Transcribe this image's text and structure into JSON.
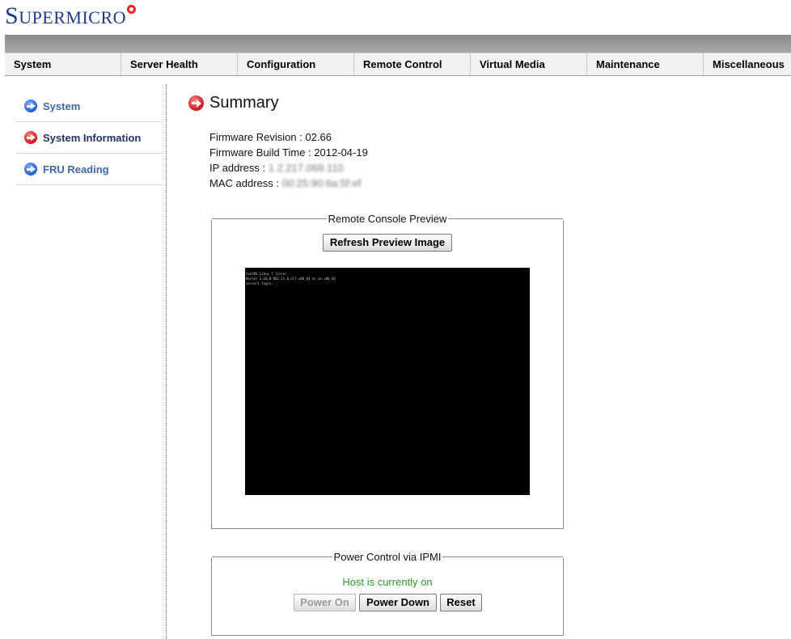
{
  "brand": {
    "logo_text_big": "S",
    "logo_text_rest": "UPERMICRO"
  },
  "nav": {
    "items": [
      "System",
      "Server Health",
      "Configuration",
      "Remote Control",
      "Virtual Media",
      "Maintenance",
      "Miscellaneous"
    ]
  },
  "sidebar": {
    "items": [
      {
        "label": "System",
        "icon": "arrow-right-blue-icon"
      },
      {
        "label": "System Information",
        "icon": "arrow-right-red-icon",
        "active": true
      },
      {
        "label": "FRU Reading",
        "icon": "arrow-right-blue-icon"
      }
    ]
  },
  "summary": {
    "title": "Summary",
    "firmware_revision_label": "Firmware Revision :",
    "firmware_revision": "02.66",
    "firmware_build_label": "Firmware Build Time :",
    "firmware_build": "2012-04-19",
    "ip_label": "IP address :",
    "ip_value": "1.2.217.069.110",
    "mac_label": "MAC address :",
    "mac_value": "00:25:90:6a:5f:ef"
  },
  "console_preview": {
    "legend": "Remote Console Preview",
    "refresh_button": "Refresh Preview Image",
    "screen_lines": [
      "CentOS Linux 7 (Core)",
      "Kernel 3.10.0-862.11.6.el7.x86_64 on an x86_64",
      "",
      "server1 login: _"
    ]
  },
  "power": {
    "legend": "Power Control via IPMI",
    "status": "Host is currently on",
    "status_color": "#2c9a2c",
    "power_on": "Power On",
    "power_down": "Power Down",
    "reset": "Reset"
  }
}
